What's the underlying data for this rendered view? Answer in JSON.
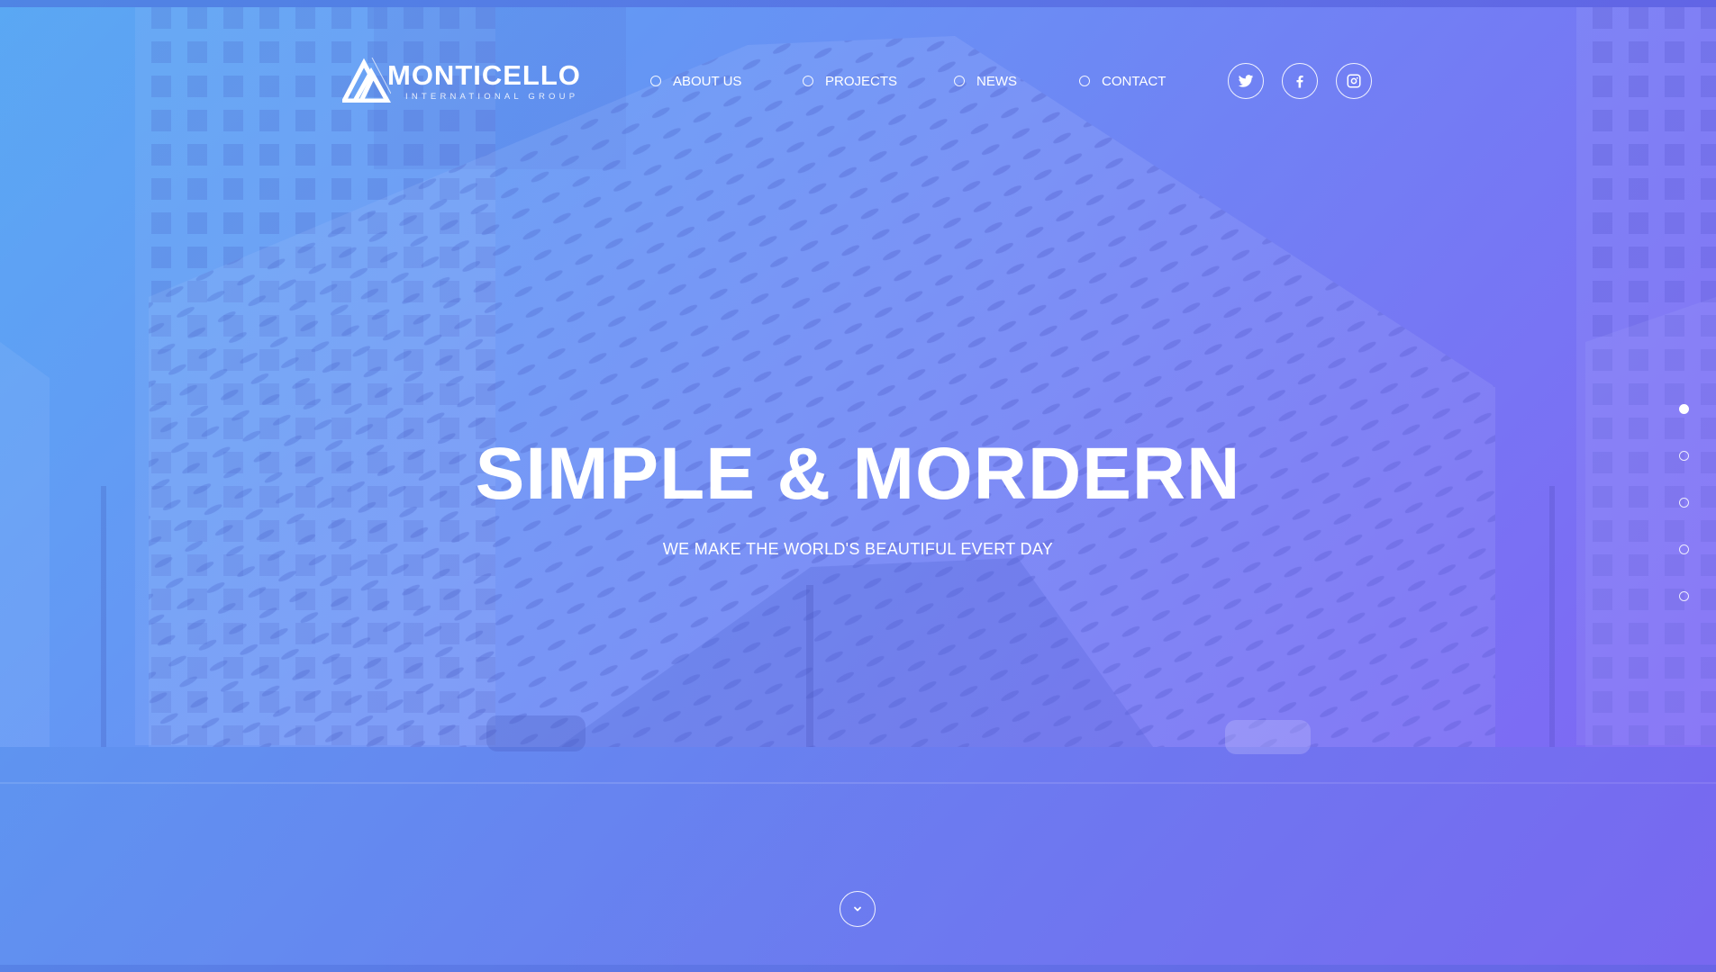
{
  "brand": {
    "name": "MONTICELLO",
    "tagline": "INTERNATIONAL GROUP"
  },
  "nav": {
    "items": [
      {
        "label": "ABOUT US"
      },
      {
        "label": "PROJECTS"
      },
      {
        "label": "NEWS"
      },
      {
        "label": "CONTACT"
      }
    ]
  },
  "social": {
    "icons": [
      "twitter-icon",
      "facebook-icon",
      "instagram-icon"
    ]
  },
  "hero": {
    "title": "SIMPLE & MORDERN",
    "subtitle": "WE MAKE THE WORLD'S BEAUTIFUL EVERT DAY"
  },
  "pagination": {
    "count": 5,
    "active_index": 0
  },
  "scroll": {
    "icon": "chevron-down-icon"
  },
  "colors": {
    "gradient_start": "#5aa6f2",
    "gradient_mid": "#6c8cf4",
    "gradient_end": "#7f68f2",
    "text": "#ffffff"
  }
}
